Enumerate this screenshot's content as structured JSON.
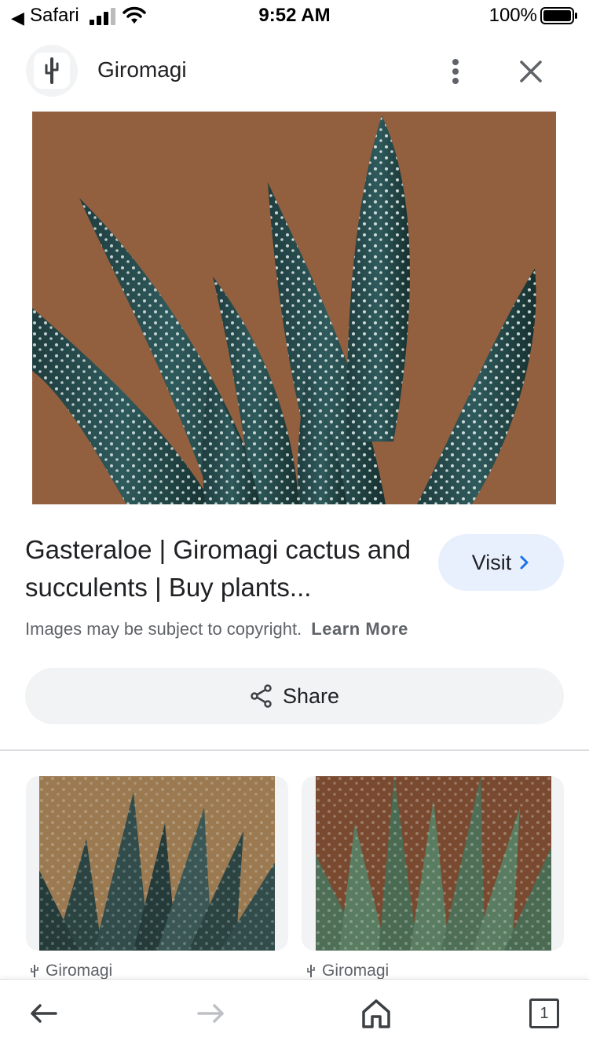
{
  "status_bar": {
    "back_app": "Safari",
    "time": "9:52 AM",
    "battery": "100%"
  },
  "header": {
    "site_name": "Giromagi",
    "icons": [
      "cactus-logo-icon",
      "more-vert-icon",
      "close-icon"
    ]
  },
  "result": {
    "title": "Gasteraloe | Giromagi cactus and succulents | Buy plants...",
    "visit_label": "Visit",
    "copyright_text": "Images may be subject to copyright.",
    "learn_more": "Learn More",
    "share_label": "Share"
  },
  "related": [
    {
      "source": "Giromagi"
    },
    {
      "source": "Giromagi"
    }
  ],
  "toolbar": {
    "tab_count": "1",
    "icons": [
      "back-arrow-icon",
      "forward-arrow-icon",
      "home-icon",
      "tabs-icon"
    ]
  },
  "colors": {
    "visit_bg": "#e8f0fe",
    "visit_chevron": "#1a73e8",
    "share_bg": "#f1f3f4",
    "text_primary": "#202124",
    "text_secondary": "#5f6368"
  }
}
